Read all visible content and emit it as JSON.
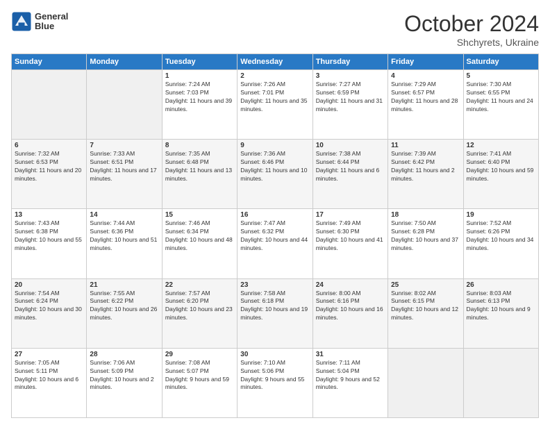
{
  "header": {
    "logo_line1": "General",
    "logo_line2": "Blue",
    "month": "October 2024",
    "location": "Shchyrets, Ukraine"
  },
  "weekdays": [
    "Sunday",
    "Monday",
    "Tuesday",
    "Wednesday",
    "Thursday",
    "Friday",
    "Saturday"
  ],
  "weeks": [
    [
      {
        "day": "",
        "sunrise": "",
        "sunset": "",
        "daylight": ""
      },
      {
        "day": "",
        "sunrise": "",
        "sunset": "",
        "daylight": ""
      },
      {
        "day": "1",
        "sunrise": "Sunrise: 7:24 AM",
        "sunset": "Sunset: 7:03 PM",
        "daylight": "Daylight: 11 hours and 39 minutes."
      },
      {
        "day": "2",
        "sunrise": "Sunrise: 7:26 AM",
        "sunset": "Sunset: 7:01 PM",
        "daylight": "Daylight: 11 hours and 35 minutes."
      },
      {
        "day": "3",
        "sunrise": "Sunrise: 7:27 AM",
        "sunset": "Sunset: 6:59 PM",
        "daylight": "Daylight: 11 hours and 31 minutes."
      },
      {
        "day": "4",
        "sunrise": "Sunrise: 7:29 AM",
        "sunset": "Sunset: 6:57 PM",
        "daylight": "Daylight: 11 hours and 28 minutes."
      },
      {
        "day": "5",
        "sunrise": "Sunrise: 7:30 AM",
        "sunset": "Sunset: 6:55 PM",
        "daylight": "Daylight: 11 hours and 24 minutes."
      }
    ],
    [
      {
        "day": "6",
        "sunrise": "Sunrise: 7:32 AM",
        "sunset": "Sunset: 6:53 PM",
        "daylight": "Daylight: 11 hours and 20 minutes."
      },
      {
        "day": "7",
        "sunrise": "Sunrise: 7:33 AM",
        "sunset": "Sunset: 6:51 PM",
        "daylight": "Daylight: 11 hours and 17 minutes."
      },
      {
        "day": "8",
        "sunrise": "Sunrise: 7:35 AM",
        "sunset": "Sunset: 6:48 PM",
        "daylight": "Daylight: 11 hours and 13 minutes."
      },
      {
        "day": "9",
        "sunrise": "Sunrise: 7:36 AM",
        "sunset": "Sunset: 6:46 PM",
        "daylight": "Daylight: 11 hours and 10 minutes."
      },
      {
        "day": "10",
        "sunrise": "Sunrise: 7:38 AM",
        "sunset": "Sunset: 6:44 PM",
        "daylight": "Daylight: 11 hours and 6 minutes."
      },
      {
        "day": "11",
        "sunrise": "Sunrise: 7:39 AM",
        "sunset": "Sunset: 6:42 PM",
        "daylight": "Daylight: 11 hours and 2 minutes."
      },
      {
        "day": "12",
        "sunrise": "Sunrise: 7:41 AM",
        "sunset": "Sunset: 6:40 PM",
        "daylight": "Daylight: 10 hours and 59 minutes."
      }
    ],
    [
      {
        "day": "13",
        "sunrise": "Sunrise: 7:43 AM",
        "sunset": "Sunset: 6:38 PM",
        "daylight": "Daylight: 10 hours and 55 minutes."
      },
      {
        "day": "14",
        "sunrise": "Sunrise: 7:44 AM",
        "sunset": "Sunset: 6:36 PM",
        "daylight": "Daylight: 10 hours and 51 minutes."
      },
      {
        "day": "15",
        "sunrise": "Sunrise: 7:46 AM",
        "sunset": "Sunset: 6:34 PM",
        "daylight": "Daylight: 10 hours and 48 minutes."
      },
      {
        "day": "16",
        "sunrise": "Sunrise: 7:47 AM",
        "sunset": "Sunset: 6:32 PM",
        "daylight": "Daylight: 10 hours and 44 minutes."
      },
      {
        "day": "17",
        "sunrise": "Sunrise: 7:49 AM",
        "sunset": "Sunset: 6:30 PM",
        "daylight": "Daylight: 10 hours and 41 minutes."
      },
      {
        "day": "18",
        "sunrise": "Sunrise: 7:50 AM",
        "sunset": "Sunset: 6:28 PM",
        "daylight": "Daylight: 10 hours and 37 minutes."
      },
      {
        "day": "19",
        "sunrise": "Sunrise: 7:52 AM",
        "sunset": "Sunset: 6:26 PM",
        "daylight": "Daylight: 10 hours and 34 minutes."
      }
    ],
    [
      {
        "day": "20",
        "sunrise": "Sunrise: 7:54 AM",
        "sunset": "Sunset: 6:24 PM",
        "daylight": "Daylight: 10 hours and 30 minutes."
      },
      {
        "day": "21",
        "sunrise": "Sunrise: 7:55 AM",
        "sunset": "Sunset: 6:22 PM",
        "daylight": "Daylight: 10 hours and 26 minutes."
      },
      {
        "day": "22",
        "sunrise": "Sunrise: 7:57 AM",
        "sunset": "Sunset: 6:20 PM",
        "daylight": "Daylight: 10 hours and 23 minutes."
      },
      {
        "day": "23",
        "sunrise": "Sunrise: 7:58 AM",
        "sunset": "Sunset: 6:18 PM",
        "daylight": "Daylight: 10 hours and 19 minutes."
      },
      {
        "day": "24",
        "sunrise": "Sunrise: 8:00 AM",
        "sunset": "Sunset: 6:16 PM",
        "daylight": "Daylight: 10 hours and 16 minutes."
      },
      {
        "day": "25",
        "sunrise": "Sunrise: 8:02 AM",
        "sunset": "Sunset: 6:15 PM",
        "daylight": "Daylight: 10 hours and 12 minutes."
      },
      {
        "day": "26",
        "sunrise": "Sunrise: 8:03 AM",
        "sunset": "Sunset: 6:13 PM",
        "daylight": "Daylight: 10 hours and 9 minutes."
      }
    ],
    [
      {
        "day": "27",
        "sunrise": "Sunrise: 7:05 AM",
        "sunset": "Sunset: 5:11 PM",
        "daylight": "Daylight: 10 hours and 6 minutes."
      },
      {
        "day": "28",
        "sunrise": "Sunrise: 7:06 AM",
        "sunset": "Sunset: 5:09 PM",
        "daylight": "Daylight: 10 hours and 2 minutes."
      },
      {
        "day": "29",
        "sunrise": "Sunrise: 7:08 AM",
        "sunset": "Sunset: 5:07 PM",
        "daylight": "Daylight: 9 hours and 59 minutes."
      },
      {
        "day": "30",
        "sunrise": "Sunrise: 7:10 AM",
        "sunset": "Sunset: 5:06 PM",
        "daylight": "Daylight: 9 hours and 55 minutes."
      },
      {
        "day": "31",
        "sunrise": "Sunrise: 7:11 AM",
        "sunset": "Sunset: 5:04 PM",
        "daylight": "Daylight: 9 hours and 52 minutes."
      },
      {
        "day": "",
        "sunrise": "",
        "sunset": "",
        "daylight": ""
      },
      {
        "day": "",
        "sunrise": "",
        "sunset": "",
        "daylight": ""
      }
    ]
  ]
}
